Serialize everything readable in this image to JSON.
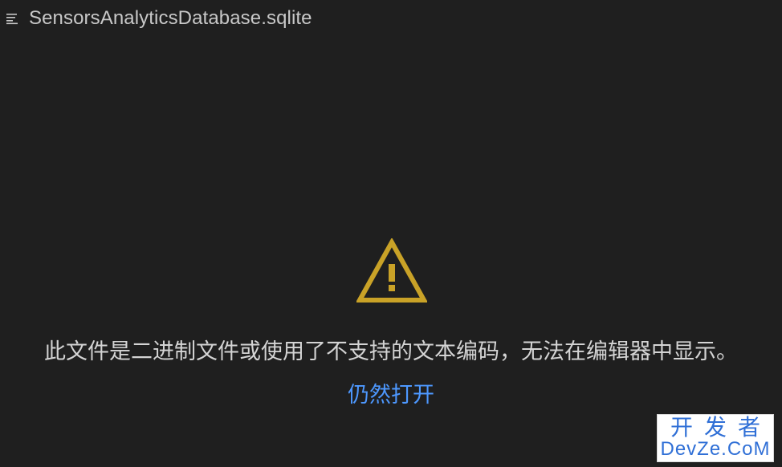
{
  "tab": {
    "icon": "file-lines-icon",
    "title": "SensorsAnalyticsDatabase.sqlite"
  },
  "content": {
    "icon": "warning-icon",
    "message": "此文件是二进制文件或使用了不支持的文本编码，无法在编辑器中显示。",
    "open_anyway_label": "仍然打开"
  },
  "colors": {
    "background": "#1f1f1f",
    "warning": "#c9a227",
    "link": "#4d98ff"
  },
  "watermark": {
    "top": "开发者",
    "bottom": "DevZe.CoM"
  }
}
